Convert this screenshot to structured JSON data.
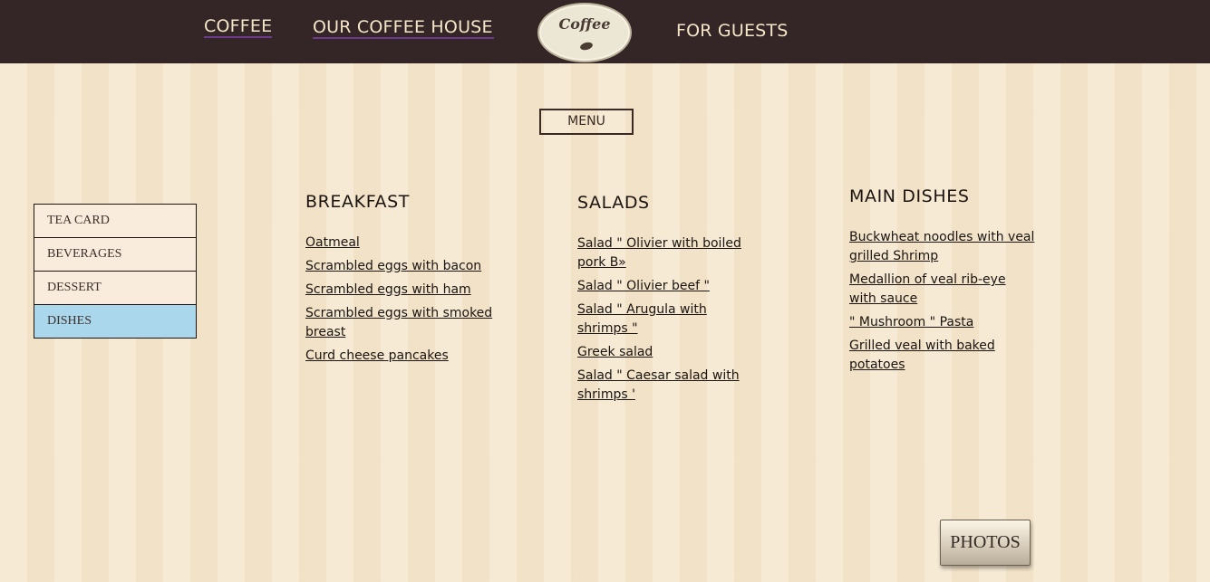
{
  "header": {
    "nav": {
      "coffee": "COFFEE",
      "coffee_house": "OUR COFFEE HOUSE",
      "for_guests": "FOR GUESTS"
    },
    "logo_text": "Coffee",
    "background_color": "#342626"
  },
  "menu_button": "MENU",
  "sidebar": {
    "items": [
      {
        "label": "TEA CARD",
        "active": false
      },
      {
        "label": "BEVERAGES",
        "active": false
      },
      {
        "label": "DESSERT",
        "active": false
      },
      {
        "label": "DISHES",
        "active": true
      }
    ],
    "active_color": "#aad7eb"
  },
  "sections": {
    "breakfast": {
      "title": "BREAKFAST",
      "items": [
        "Oatmeal",
        "Scrambled eggs with bacon",
        "Scrambled eggs with ham",
        "Scrambled eggs with smoked breast",
        "Curd cheese pancakes"
      ]
    },
    "salads": {
      "title": "SALADS",
      "items": [
        "Salad \" Olivier with boiled pork B»",
        "Salad \" Olivier beef \"",
        "Salad \" Arugula with shrimps \"",
        "Greek salad",
        "Salad \" Caesar salad with shrimps '"
      ]
    },
    "main_dishes": {
      "title": "MAIN DISHES",
      "items": [
        "Buckwheat noodles with veal grilled Shrimp",
        "Medallion of veal rib-eye with sauce",
        "\" Mushroom \" Pasta",
        "Grilled veal with baked potatoes"
      ]
    }
  },
  "photos_button": "PHOTOS"
}
